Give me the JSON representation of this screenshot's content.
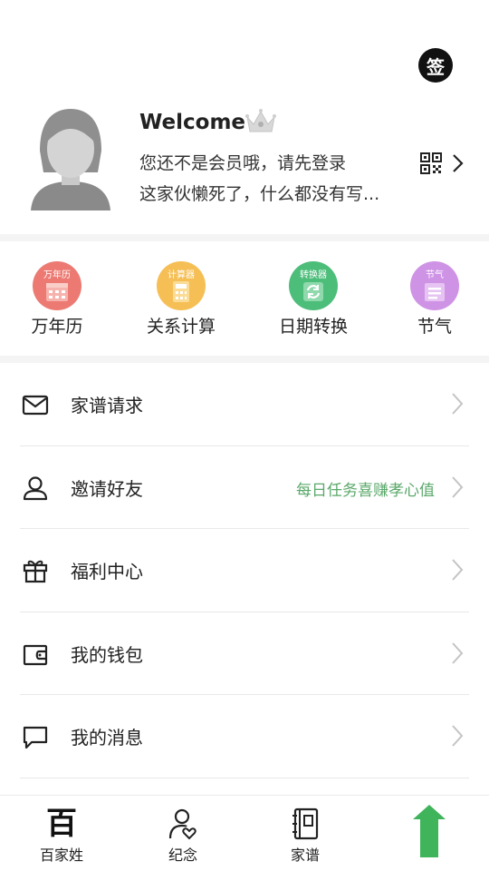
{
  "profile": {
    "sign_label": "签",
    "welcome": "Welcome",
    "status": "您还不是会员哦，请先登录",
    "bio": "这家伙懒死了，什么都没有写..."
  },
  "tools": [
    {
      "label": "万年历",
      "tag": "万年历",
      "color": "#ec7a72",
      "icon": "calendar-icon"
    },
    {
      "label": "关系计算",
      "tag": "计算器",
      "color": "#f6bf55",
      "icon": "calculator-icon"
    },
    {
      "label": "日期转换",
      "tag": "转换器",
      "color": "#4dbd7a",
      "icon": "convert-icon"
    },
    {
      "label": "节气",
      "tag": "节气",
      "color": "#cf93e6",
      "icon": "solar-term-icon"
    }
  ],
  "menu": [
    {
      "label": "家谱请求",
      "hint": "",
      "icon": "mail-icon"
    },
    {
      "label": "邀请好友",
      "hint": "每日任务喜赚孝心值",
      "icon": "user-icon"
    },
    {
      "label": "福利中心",
      "hint": "",
      "icon": "gift-icon"
    },
    {
      "label": "我的钱包",
      "hint": "",
      "icon": "wallet-icon"
    },
    {
      "label": "我的消息",
      "hint": "",
      "icon": "message-icon"
    }
  ],
  "nav": [
    {
      "label": "百家姓",
      "glyph": "百",
      "icon": "surname-icon"
    },
    {
      "label": "纪念",
      "icon": "memorial-icon"
    },
    {
      "label": "家谱",
      "icon": "genealogy-icon"
    },
    {
      "label": "",
      "icon": "up-arrow-icon"
    }
  ],
  "colors": {
    "accent_green": "#5aa86a",
    "nav_green": "#3fb45a"
  }
}
